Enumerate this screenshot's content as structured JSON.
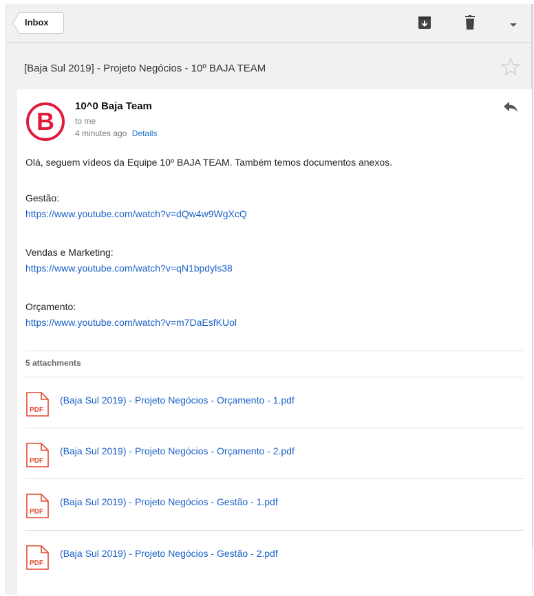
{
  "toolbar": {
    "back_label": "Inbox",
    "icons": [
      "archive-icon",
      "trash-icon",
      "more-dropdown-icon"
    ]
  },
  "subject": "[Baja Sul 2019] - Projeto Negócios - 10º BAJA TEAM",
  "message": {
    "avatar_letter": "B",
    "sender": "10^0 Baja Team",
    "to": "to me",
    "time": "4 minutes ago",
    "details_label": "Details",
    "intro": "Olá, seguem vídeos da Equipe 10º BAJA TEAM. Também temos documentos anexos.",
    "sections": [
      {
        "label": "Gestão:",
        "url": "https://www.youtube.com/watch?v=dQw4w9WgXcQ"
      },
      {
        "label": "Vendas e Marketing:",
        "url": "https://www.youtube.com/watch?v=qN1bpdyls38"
      },
      {
        "label": "Orçamento:",
        "url": "https://www.youtube.com/watch?v=m7DaEsfKUol"
      }
    ]
  },
  "attachments": {
    "count_label": "5 attachments",
    "icon_label": "PDF",
    "items": [
      "(Baja Sul 2019) - Projeto Negócios - Orçamento - 1.pdf",
      "(Baja Sul 2019) - Projeto Negócios - Orçamento - 2.pdf",
      "(Baja Sul 2019) - Projeto Negócios - Gestão - 1.pdf",
      "(Baja Sul 2019) - Projeto Negócios - Gestão - 2.pdf"
    ]
  },
  "colors": {
    "brand_red": "#e31b3b",
    "link_blue": "#1a60c8",
    "pdf_red": "#e2492f"
  }
}
